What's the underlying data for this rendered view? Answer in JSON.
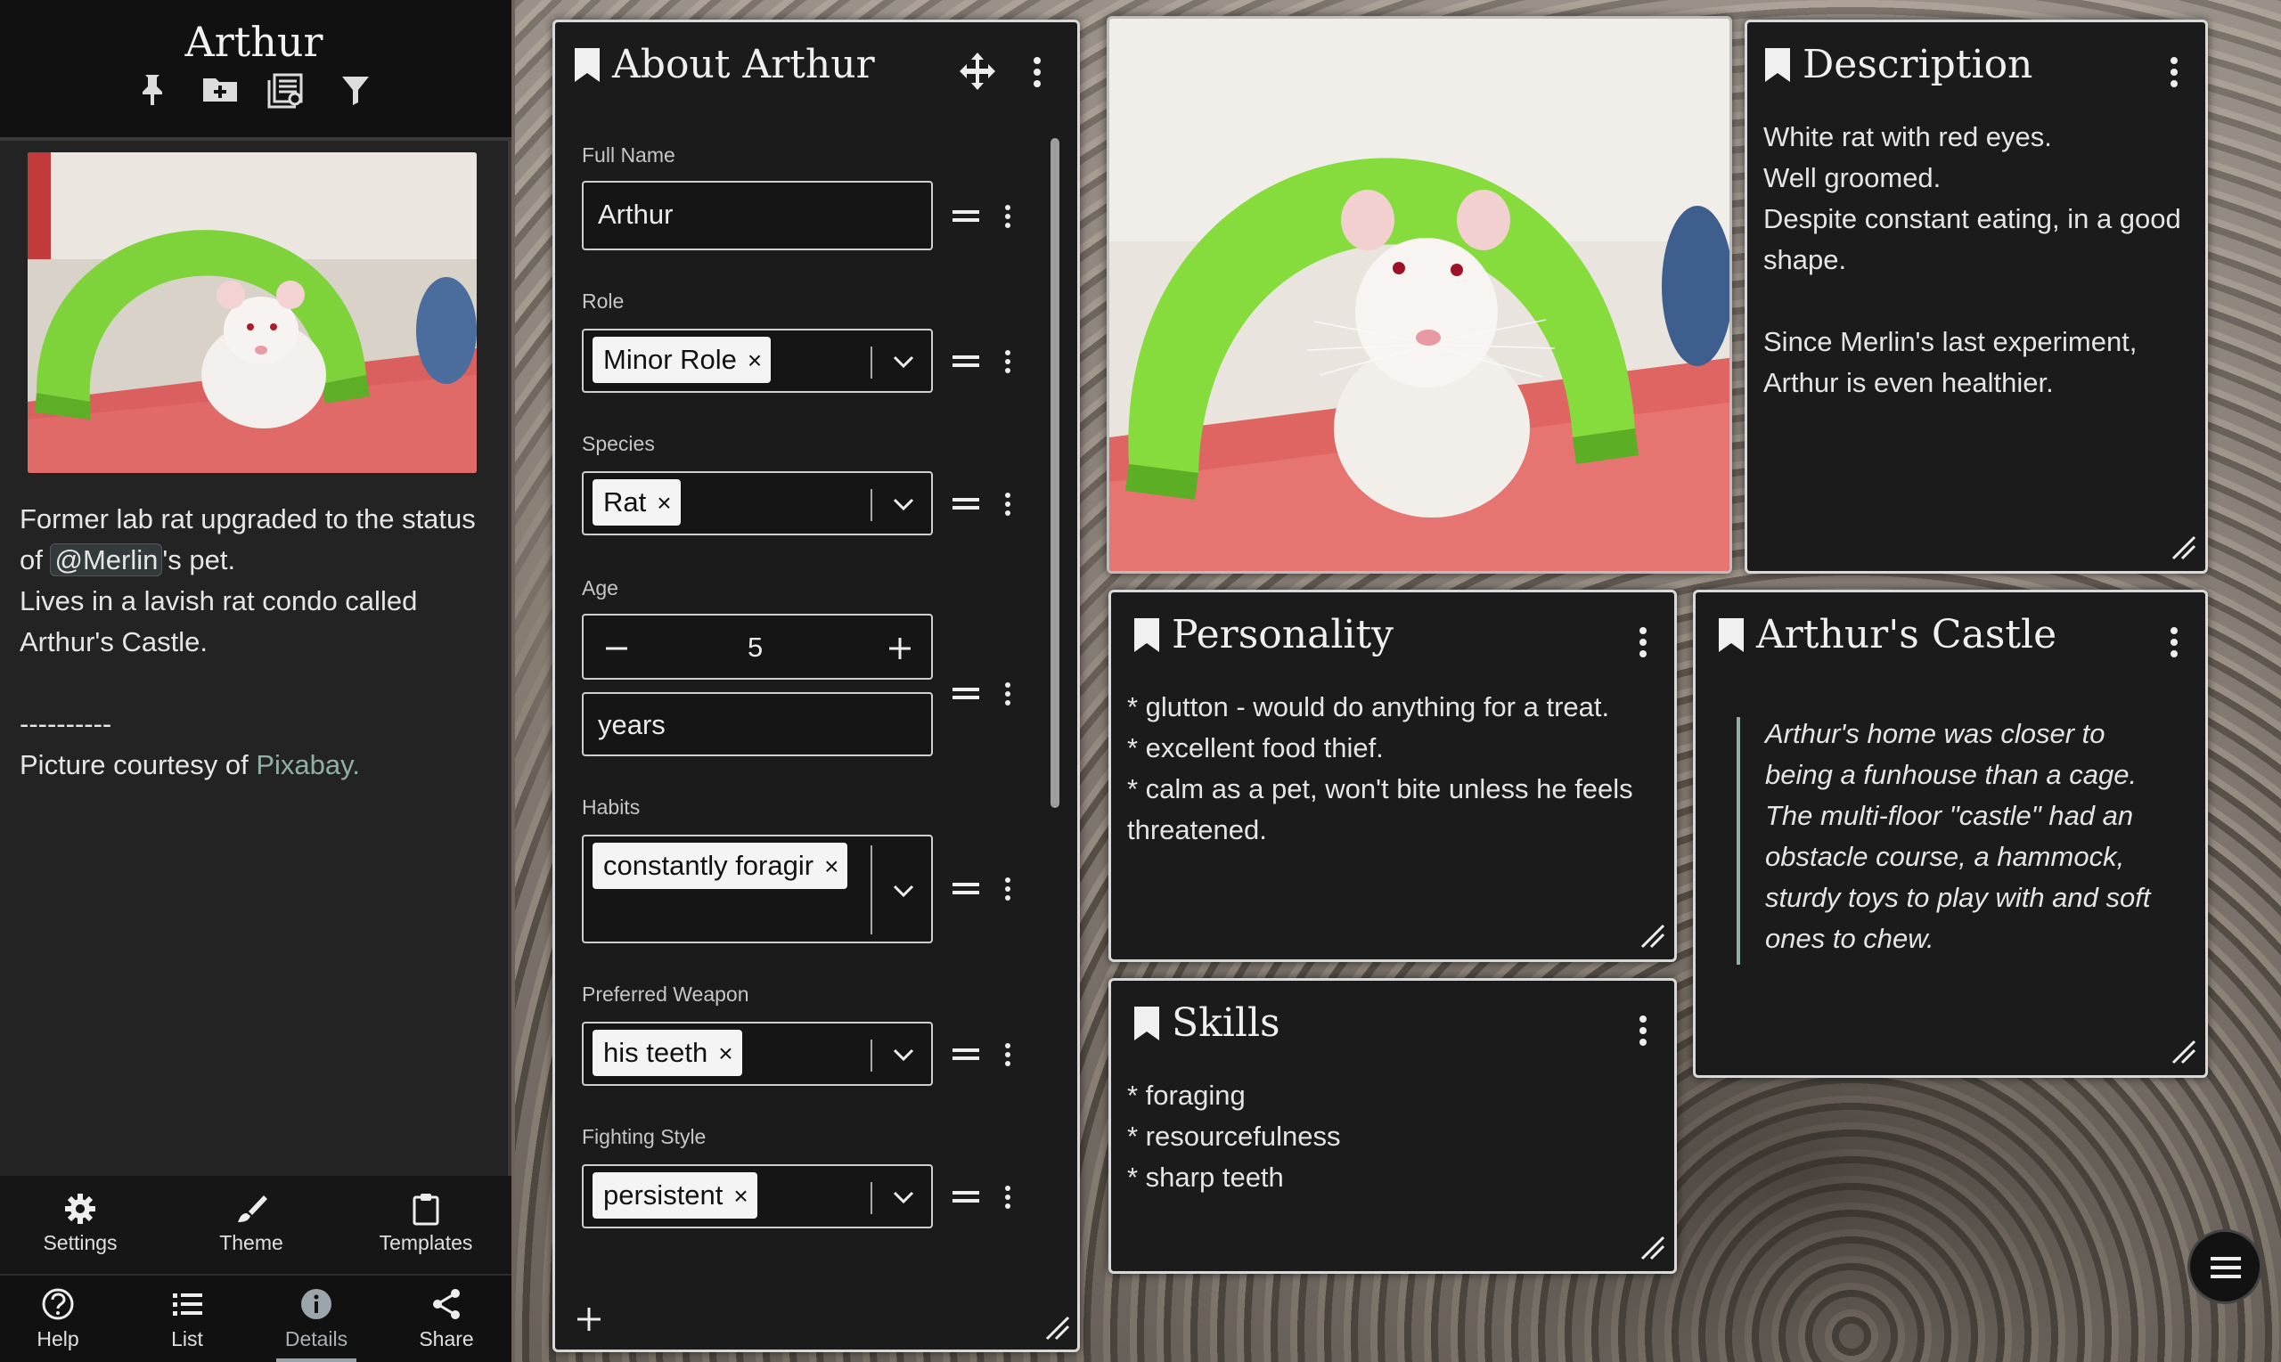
{
  "sidebar": {
    "title": "Arthur",
    "header_icons": [
      "pin-icon",
      "folder-plus-icon",
      "library-icon",
      "filter-icon"
    ],
    "summary": {
      "line1_prefix": "Former lab rat upgraded to the status of ",
      "mention": "@Merlin",
      "line1_suffix": "'s pet.",
      "line2": "Lives in a lavish rat condo called Arthur's Castle.",
      "separator": "----------",
      "credit_prefix": "Picture courtesy of ",
      "credit_link": "Pixabay."
    },
    "tools": [
      {
        "label": "Settings",
        "icon": "gear-icon"
      },
      {
        "label": "Theme",
        "icon": "brush-icon"
      },
      {
        "label": "Templates",
        "icon": "clipboard-icon"
      }
    ],
    "nav": [
      {
        "label": "Help",
        "icon": "help-icon"
      },
      {
        "label": "List",
        "icon": "list-icon"
      },
      {
        "label": "Details",
        "icon": "info-icon",
        "active": true
      },
      {
        "label": "Share",
        "icon": "share-icon"
      }
    ]
  },
  "about": {
    "title": "About Arthur",
    "full_name_label": "Full Name",
    "full_name_value": "Arthur",
    "role_label": "Role",
    "role_value": "Minor Role",
    "species_label": "Species",
    "species_value": "Rat",
    "age_label": "Age",
    "age_value": "5",
    "age_unit": "years",
    "habits_label": "Habits",
    "habits_value": "constantly foragir",
    "weapon_label": "Preferred Weapon",
    "weapon_value": "his teeth",
    "fighting_label": "Fighting Style",
    "fighting_value": "persistent",
    "remove_glyph": "×"
  },
  "description": {
    "title": "Description",
    "lines": [
      "White rat with red eyes.",
      "Well groomed.",
      "Despite constant eating, in a good",
      "shape.",
      "",
      "Since Merlin's last experiment,",
      "Arthur is even healthier."
    ]
  },
  "personality": {
    "title": "Personality",
    "lines": [
      "* glutton - would do anything for a treat.",
      "* excellent food thief.",
      "* calm as a pet, won't bite unless he feels",
      "threatened."
    ]
  },
  "skills": {
    "title": "Skills",
    "lines": [
      "* foraging",
      "* resourcefulness",
      "* sharp teeth"
    ]
  },
  "castle": {
    "title": "Arthur's Castle",
    "quote_lines": [
      "Arthur's home was closer to",
      "being a funhouse than a cage.",
      "The multi-floor \"castle\" had an",
      "obstacle course, a hammock,",
      "sturdy toys to play with and soft",
      "ones to chew."
    ]
  },
  "colors": {
    "card_bg": "#1b1b1b",
    "card_border": "#d9d9d9",
    "link": "#8fb0a6",
    "sidebar_bg": "#232323"
  }
}
